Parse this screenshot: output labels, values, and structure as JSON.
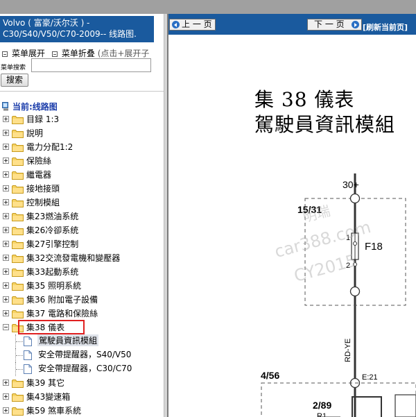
{
  "left_panel": {
    "title_line1": "Volvo ( 富豪/沃尔沃 ) -",
    "title_line2": "C30/S40/V50/C70-2009-- 线路图.",
    "menu_expand": "菜单展开",
    "menu_collapse": "菜单折叠",
    "menu_hint": "(点击+展开子",
    "search_label": "菜单搜索",
    "search_value": "",
    "search_button": "搜索",
    "current_label": "当前:线路图",
    "tree": [
      {
        "label": "目録 1:3",
        "state": "plus"
      },
      {
        "label": "說明",
        "state": "plus"
      },
      {
        "label": "電力分配1:2",
        "state": "plus"
      },
      {
        "label": "保險絲",
        "state": "plus"
      },
      {
        "label": "繼電器",
        "state": "plus"
      },
      {
        "label": "接地接頭",
        "state": "plus"
      },
      {
        "label": "控制模組",
        "state": "plus"
      },
      {
        "label": "集23燃油系统",
        "state": "plus"
      },
      {
        "label": "集26冷卻系统",
        "state": "plus"
      },
      {
        "label": "集27引擎控制",
        "state": "plus"
      },
      {
        "label": "集32交流發電機和變壓器",
        "state": "plus"
      },
      {
        "label": "集33起動系统",
        "state": "plus"
      },
      {
        "label": "集35 照明系統",
        "state": "plus"
      },
      {
        "label": "集36 附加電子設備",
        "state": "plus"
      },
      {
        "label": "集37 電路和保險絲",
        "state": "plus"
      },
      {
        "label": "集38 儀表",
        "state": "minus"
      },
      {
        "label": "集39 其它",
        "state": "plus"
      },
      {
        "label": "集43變速箱",
        "state": "plus"
      },
      {
        "label": "集59 煞車系統",
        "state": "plus"
      }
    ],
    "subitems": [
      {
        "label": "駕駛員資訊模組",
        "selected": true
      },
      {
        "label": "安全帶提醒器，S40/V50",
        "selected": false
      },
      {
        "label": "安全帶提醒器，C30/C70",
        "selected": false
      }
    ]
  },
  "nav": {
    "prev": "上 一 页",
    "next": "下 一 页",
    "refresh": "[刷新当前页]"
  },
  "diagram": {
    "title_line1": "集 38  儀表",
    "title_line2": "駕駛員資訊模組",
    "labels": {
      "supply": "30+",
      "conn1": "15/31",
      "pin1": "1",
      "pin2": "2",
      "fuse": "F18",
      "wire": "RD-YE",
      "conn2": "4/56",
      "junction": "E:21",
      "conn3": "2/89",
      "r1": "R1"
    },
    "watermark": [
      "明瑞",
      "car388.com",
      "CY2015"
    ]
  },
  "colors": {
    "title_bar": "#1a5a9e",
    "highlight": "#e02020",
    "current_text": "#1a3caa"
  }
}
